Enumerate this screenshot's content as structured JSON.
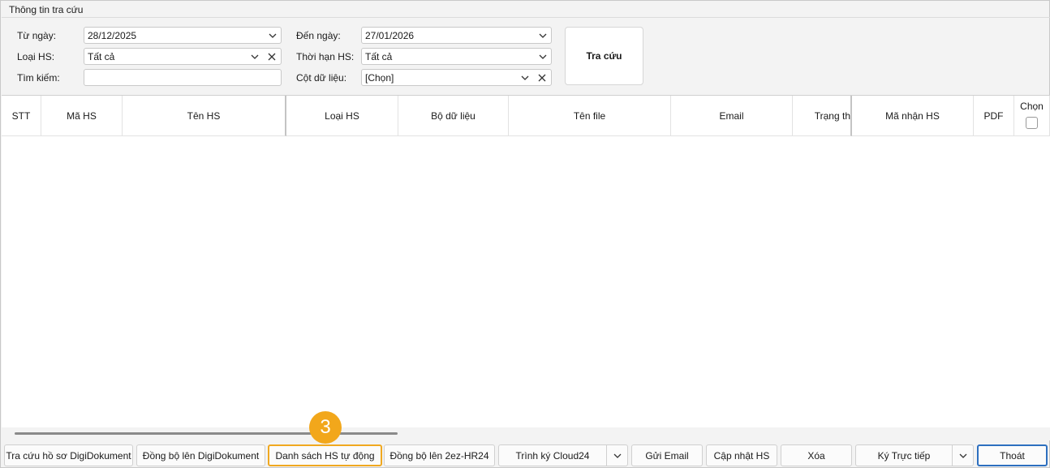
{
  "group_title": "Thông tin tra cứu",
  "form": {
    "from_date_label": "Từ ngày:",
    "from_date_value": "28/12/2025",
    "to_date_label": "Đến ngày:",
    "to_date_value": "27/01/2026",
    "type_label": "Loại HS:",
    "type_value": "Tất cả",
    "term_label": "Thời hạn HS:",
    "term_value": "Tất cả",
    "search_label": "Tìm kiếm:",
    "search_value": "",
    "column_label": "Cột dữ liệu:",
    "column_value": "[Chọn]",
    "search_button": "Tra cứu"
  },
  "grid": {
    "columns": [
      "STT",
      "Mã HS",
      "Tên HS",
      "Loại HS",
      "Bộ dữ liệu",
      "Tên file",
      "Email",
      "Trạng th",
      "Mã nhận HS",
      "PDF",
      "Chọn"
    ]
  },
  "annotation": {
    "step": "3"
  },
  "toolbar": {
    "lookup_digidokument": "Tra cứu hồ sơ DigiDokument",
    "sync_digidokument": "Đồng bộ lên DigiDokument",
    "auto_list": "Danh sách HS tự động",
    "sync_2ez": "Đồng bộ lên 2ez-HR24",
    "sign_cloud24": "Trình ký Cloud24",
    "send_email": "Gửi Email",
    "update_hs": "Cập nhật HS",
    "delete": "Xóa",
    "sign_direct": "Ký Trực tiếp",
    "exit": "Thoát"
  },
  "icons": {
    "dropdown": "chevron-down-icon",
    "clear": "close-icon",
    "checkbox": "checkbox-icon"
  },
  "colors": {
    "highlight": "#f0a820",
    "badge": "#f2a71b",
    "primary_border": "#2d6fbf"
  }
}
